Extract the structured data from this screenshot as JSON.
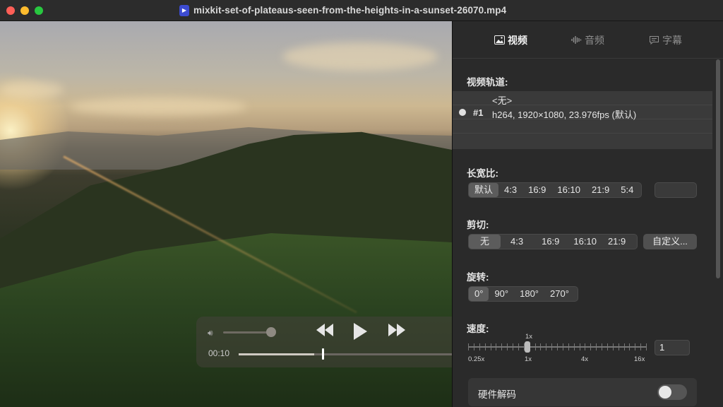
{
  "window": {
    "title": "mixkit-set-of-plateaus-seen-from-the-heights-in-a-sunset-26070.mp4"
  },
  "player": {
    "current_time": "00:10",
    "progress": 0.6,
    "volume": 0.85
  },
  "tabs": [
    {
      "label": "视频",
      "icon": "photo-icon",
      "active": true
    },
    {
      "label": "音频",
      "icon": "waveform-icon",
      "active": false
    },
    {
      "label": "字幕",
      "icon": "caption-bubble-icon",
      "active": false
    }
  ],
  "video_track": {
    "label": "视频轨道:",
    "none_option": "<无>",
    "track_id": "#1",
    "track_info": "h264, 1920×1080, 23.976fps (默认)"
  },
  "aspect_ratio": {
    "label": "长宽比:",
    "options": [
      "默认",
      "4:3",
      "16:9",
      "16:10",
      "21:9",
      "5:4"
    ],
    "selected": "默认"
  },
  "crop": {
    "label": "剪切:",
    "options": [
      "无",
      "4:3",
      "16:9",
      "16:10",
      "21:9"
    ],
    "selected": "无",
    "custom_button": "自定义..."
  },
  "rotation": {
    "label": "旋转:",
    "options": [
      "0°",
      "90°",
      "180°",
      "270°"
    ],
    "selected": "0°"
  },
  "speed": {
    "label": "速度:",
    "current_label": "1x",
    "tick_labels": [
      "0.25x",
      "1x",
      "4x",
      "16x"
    ],
    "value": "1"
  },
  "hardware_decode": {
    "label": "硬件解码",
    "enabled": false
  },
  "colors": {
    "close": "#ff5f57",
    "minimize": "#febc2e",
    "maximize": "#28c840",
    "panel_bg": "#2a2a2a"
  }
}
